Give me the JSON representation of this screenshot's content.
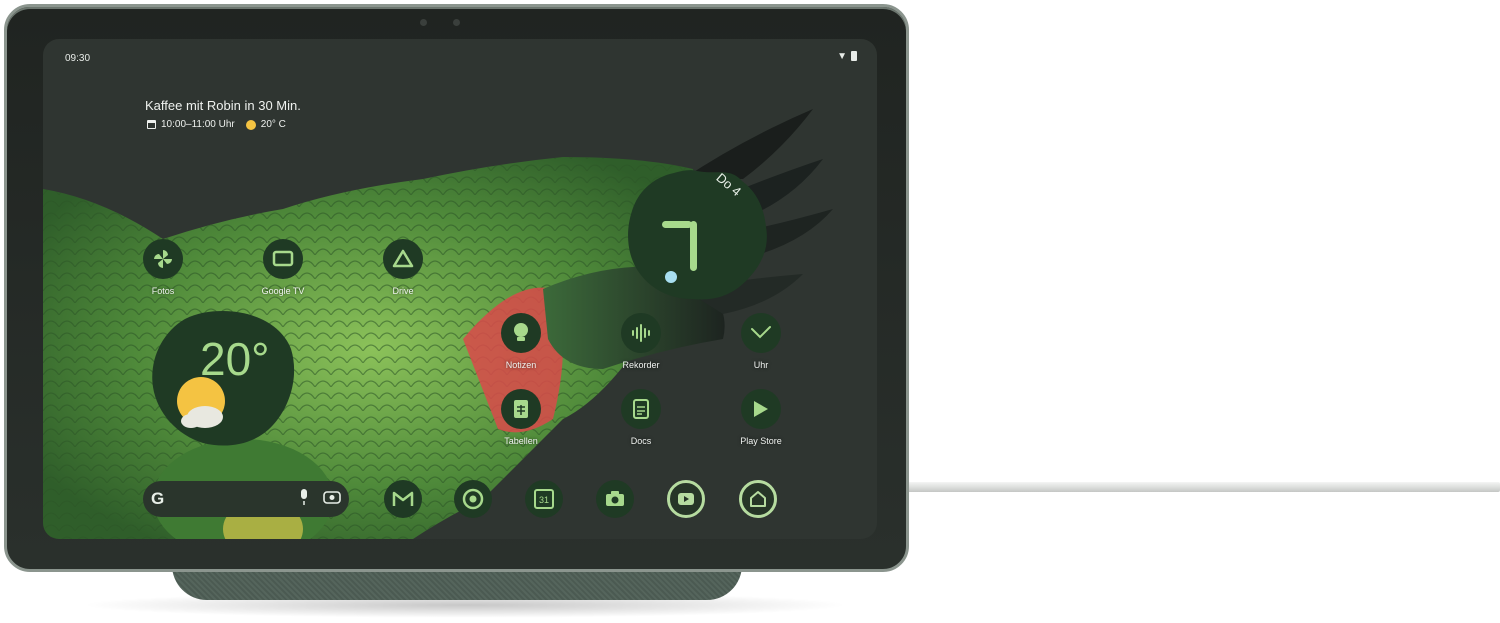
{
  "status_bar": {
    "time": "09:30"
  },
  "glance": {
    "event": "Kaffee mit Robin in 30 Min.",
    "event_time": "10:00–11:00 Uhr",
    "weather": "20° C"
  },
  "clock_widget": {
    "date": "Do 4"
  },
  "weather_widget": {
    "temperature": "20°"
  },
  "apps": [
    {
      "label": "Fotos",
      "icon": "pinwheel-icon"
    },
    {
      "label": "Google TV",
      "icon": "google-tv-icon"
    },
    {
      "label": "Drive",
      "icon": "drive-icon"
    },
    {
      "label": "Notizen",
      "icon": "lightbulb-icon"
    },
    {
      "label": "Rekorder",
      "icon": "waveform-icon"
    },
    {
      "label": "Uhr",
      "icon": "clock-hands-icon"
    },
    {
      "label": "Tabellen",
      "icon": "sheets-icon"
    },
    {
      "label": "Docs",
      "icon": "docs-icon"
    },
    {
      "label": "Play Store",
      "icon": "play-store-icon"
    }
  ],
  "dock": {
    "search_logo": "G",
    "calendar_day": "31",
    "icons": [
      "gmail-icon",
      "chrome-icon",
      "calendar-icon",
      "camera-icon",
      "youtube-icon",
      "home-icon"
    ]
  },
  "colors": {
    "screen_bg": "#2f3531",
    "icon_bg": "#1f3a24",
    "accent": "#a7d98c",
    "frame": "#8b958e"
  }
}
